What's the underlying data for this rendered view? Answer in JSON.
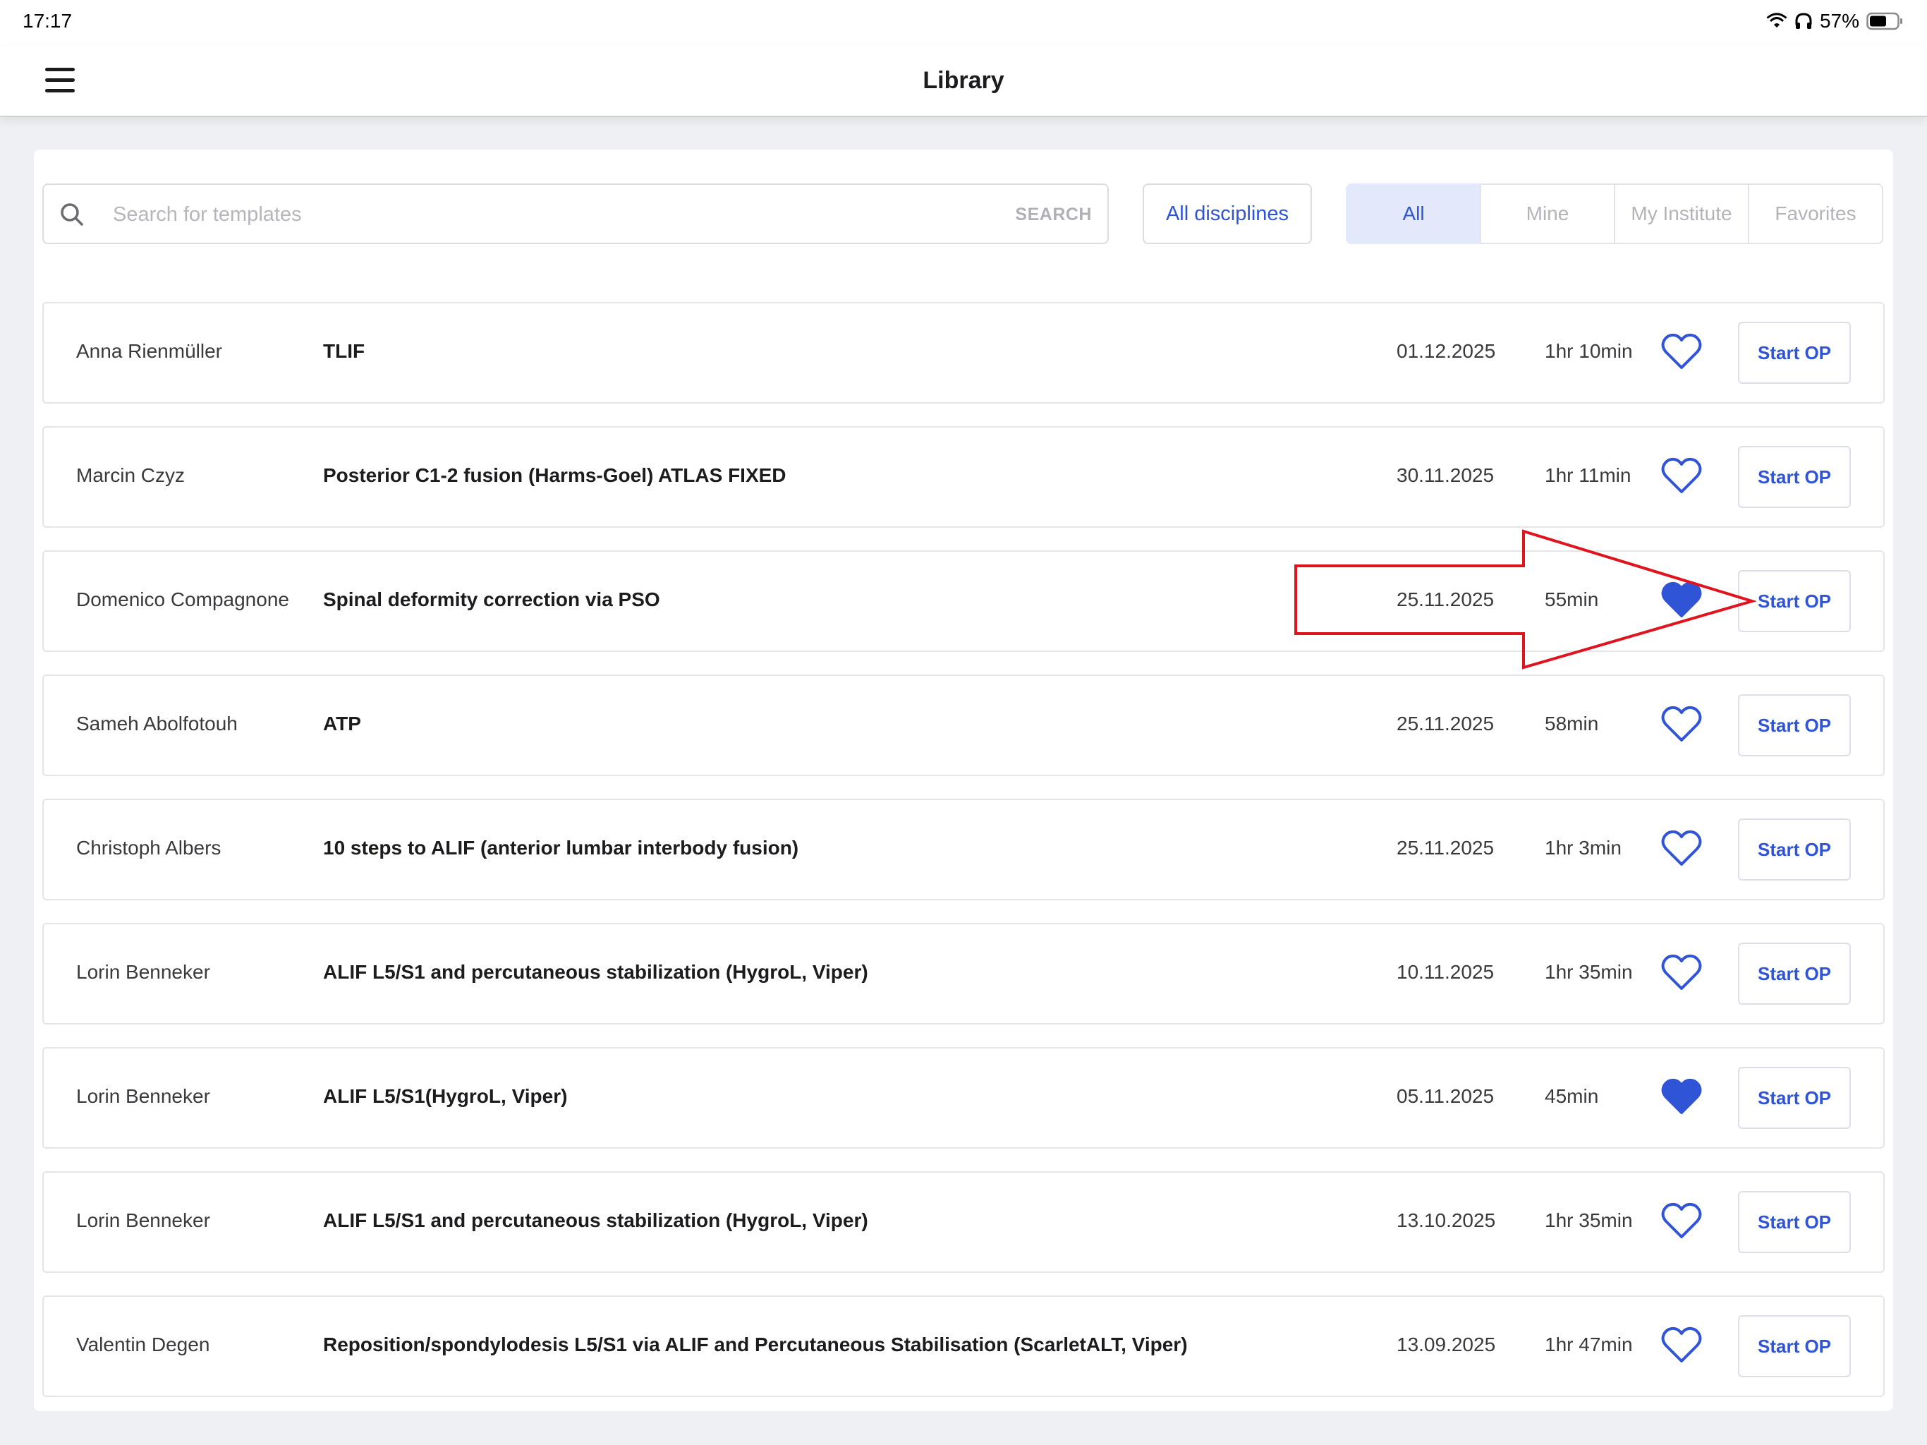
{
  "status": {
    "time": "17:17",
    "battery": "57%"
  },
  "header": {
    "title": "Library"
  },
  "search": {
    "placeholder": "Search for templates",
    "button_label": "SEARCH"
  },
  "disciplines_label": "All disciplines",
  "filters": [
    {
      "label": "All",
      "active": true
    },
    {
      "label": "Mine",
      "active": false
    },
    {
      "label": "My Institute",
      "active": false
    },
    {
      "label": "Favorites",
      "active": false
    }
  ],
  "rows": [
    {
      "author": "Anna Rienmüller",
      "title": "TLIF",
      "date": "01.12.2025",
      "duration": "1hr 10min",
      "favorite": false,
      "action": "Start OP"
    },
    {
      "author": "Marcin Czyz",
      "title": "Posterior C1-2 fusion (Harms-Goel) ATLAS FIXED",
      "date": "30.11.2025",
      "duration": "1hr 11min",
      "favorite": false,
      "action": "Start OP"
    },
    {
      "author": "Domenico Compagnone",
      "title": "Spinal deformity correction via PSO",
      "date": "25.11.2025",
      "duration": "55min",
      "favorite": true,
      "action": "Start OP"
    },
    {
      "author": "Sameh Abolfotouh",
      "title": "ATP",
      "date": "25.11.2025",
      "duration": "58min",
      "favorite": false,
      "action": "Start OP"
    },
    {
      "author": "Christoph Albers",
      "title": "10 steps to ALIF (anterior lumbar interbody fusion)",
      "date": "25.11.2025",
      "duration": "1hr 3min",
      "favorite": false,
      "action": "Start OP"
    },
    {
      "author": "Lorin Benneker",
      "title": "ALIF L5/S1 and percutaneous stabilization (HygroL, Viper)",
      "date": "10.11.2025",
      "duration": "1hr 35min",
      "favorite": false,
      "action": "Start OP"
    },
    {
      "author": "Lorin Benneker",
      "title": "ALIF L5/S1(HygroL, Viper)",
      "date": "05.11.2025",
      "duration": "45min",
      "favorite": true,
      "action": "Start OP"
    },
    {
      "author": "Lorin Benneker",
      "title": "ALIF L5/S1 and percutaneous stabilization (HygroL, Viper)",
      "date": "13.10.2025",
      "duration": "1hr 35min",
      "favorite": false,
      "action": "Start OP"
    },
    {
      "author": "Valentin Degen",
      "title": "Reposition/spondylodesis L5/S1 via ALIF and Percutaneous Stabilisation (ScarletALT, Viper)",
      "date": "13.09.2025",
      "duration": "1hr 47min",
      "favorite": false,
      "action": "Start OP"
    }
  ],
  "colors": {
    "accent": "#2f54d6",
    "active_filter_bg": "#e3e9fb",
    "annotation_arrow": "#e0141e"
  },
  "icons": {
    "menu": "hamburger-icon",
    "search": "search-icon",
    "favorite": "heart-icon",
    "wifi": "wifi-icon",
    "headphones": "headphones-icon",
    "battery": "battery-icon"
  }
}
